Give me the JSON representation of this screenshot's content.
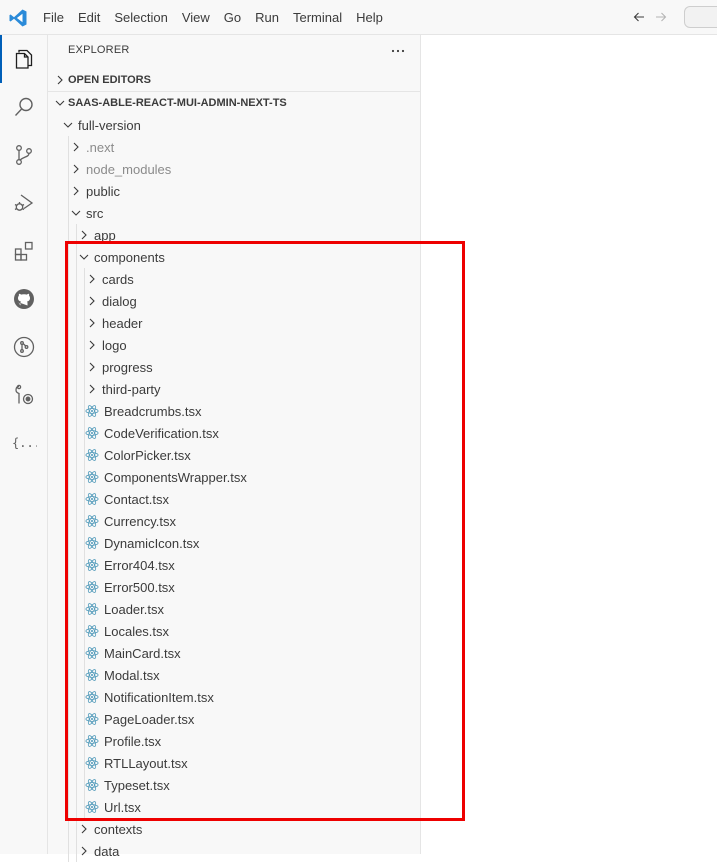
{
  "menu": [
    "File",
    "Edit",
    "Selection",
    "View",
    "Go",
    "Run",
    "Terminal",
    "Help"
  ],
  "explorer": {
    "title": "EXPLORER",
    "open_editors": "OPEN EDITORS",
    "project": "SAAS-ABLE-REACT-MUI-ADMIN-NEXT-TS"
  },
  "tree": [
    {
      "label": "full-version",
      "depth": 0,
      "kind": "folder",
      "expanded": true
    },
    {
      "label": ".next",
      "depth": 1,
      "kind": "folder",
      "expanded": false,
      "dim": true
    },
    {
      "label": "node_modules",
      "depth": 1,
      "kind": "folder",
      "expanded": false,
      "dim": true
    },
    {
      "label": "public",
      "depth": 1,
      "kind": "folder",
      "expanded": false
    },
    {
      "label": "src",
      "depth": 1,
      "kind": "folder",
      "expanded": true
    },
    {
      "label": "app",
      "depth": 2,
      "kind": "folder",
      "expanded": false
    },
    {
      "label": "components",
      "depth": 2,
      "kind": "folder",
      "expanded": true
    },
    {
      "label": "cards",
      "depth": 3,
      "kind": "folder",
      "expanded": false
    },
    {
      "label": "dialog",
      "depth": 3,
      "kind": "folder",
      "expanded": false
    },
    {
      "label": "header",
      "depth": 3,
      "kind": "folder",
      "expanded": false
    },
    {
      "label": "logo",
      "depth": 3,
      "kind": "folder",
      "expanded": false
    },
    {
      "label": "progress",
      "depth": 3,
      "kind": "folder",
      "expanded": false
    },
    {
      "label": "third-party",
      "depth": 3,
      "kind": "folder",
      "expanded": false
    },
    {
      "label": "Breadcrumbs.tsx",
      "depth": 3,
      "kind": "file"
    },
    {
      "label": "CodeVerification.tsx",
      "depth": 3,
      "kind": "file"
    },
    {
      "label": "ColorPicker.tsx",
      "depth": 3,
      "kind": "file"
    },
    {
      "label": "ComponentsWrapper.tsx",
      "depth": 3,
      "kind": "file"
    },
    {
      "label": "Contact.tsx",
      "depth": 3,
      "kind": "file"
    },
    {
      "label": "Currency.tsx",
      "depth": 3,
      "kind": "file"
    },
    {
      "label": "DynamicIcon.tsx",
      "depth": 3,
      "kind": "file"
    },
    {
      "label": "Error404.tsx",
      "depth": 3,
      "kind": "file"
    },
    {
      "label": "Error500.tsx",
      "depth": 3,
      "kind": "file"
    },
    {
      "label": "Loader.tsx",
      "depth": 3,
      "kind": "file"
    },
    {
      "label": "Locales.tsx",
      "depth": 3,
      "kind": "file"
    },
    {
      "label": "MainCard.tsx",
      "depth": 3,
      "kind": "file"
    },
    {
      "label": "Modal.tsx",
      "depth": 3,
      "kind": "file"
    },
    {
      "label": "NotificationItem.tsx",
      "depth": 3,
      "kind": "file"
    },
    {
      "label": "PageLoader.tsx",
      "depth": 3,
      "kind": "file"
    },
    {
      "label": "Profile.tsx",
      "depth": 3,
      "kind": "file"
    },
    {
      "label": "RTLLayout.tsx",
      "depth": 3,
      "kind": "file"
    },
    {
      "label": "Typeset.tsx",
      "depth": 3,
      "kind": "file"
    },
    {
      "label": "Url.tsx",
      "depth": 3,
      "kind": "file"
    },
    {
      "label": "contexts",
      "depth": 2,
      "kind": "folder",
      "expanded": false
    },
    {
      "label": "data",
      "depth": 2,
      "kind": "folder",
      "expanded": false
    }
  ],
  "activity_icons": [
    "explorer-icon",
    "search-icon",
    "source-control-icon",
    "run-debug-icon",
    "extensions-icon",
    "github-icon",
    "pull-request-icon",
    "remote-explorer-icon",
    "json-icon"
  ],
  "colors": {
    "accent": "#005fb8",
    "highlight_border": "#ee0000",
    "react_icon": "#519aba"
  }
}
